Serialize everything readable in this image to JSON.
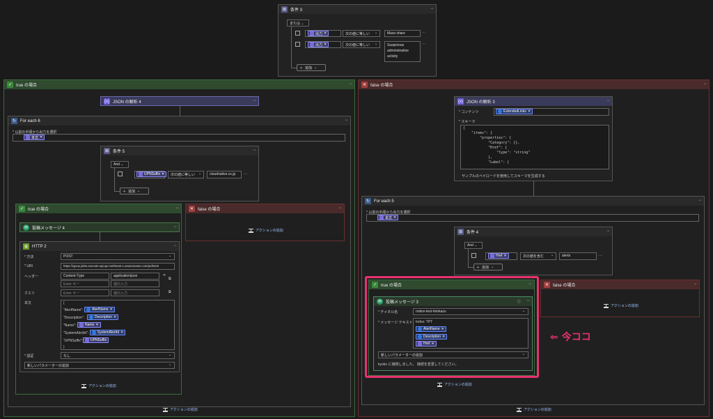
{
  "cond3": {
    "title": "条件 3",
    "logic": "または",
    "row1": {
      "token": "出力",
      "op": "次の値に等しい",
      "value": "Mass share"
    },
    "row2": {
      "token": "出力",
      "op": "次の値に等しい",
      "value": [
        "Suspicious",
        "administrative",
        "activity"
      ]
    },
    "add": "追加"
  },
  "trueBranch": {
    "title": "true の場合",
    "actionAdd": "アクションの追加"
  },
  "falseBranch": {
    "title": "false の場合",
    "actionAdd": "アクションの追加"
  },
  "json4": {
    "title": "JSON の解析 4"
  },
  "foreach6": {
    "title": "For each 6",
    "selectLabel": "* 以前の手順から出力を選択",
    "token": "本文"
  },
  "cond5": {
    "title": "条件 5",
    "logic": "And",
    "token": "UPNSuffix",
    "op": "次の値に等しい",
    "value": "cloudnative.co.jp",
    "add": "追加"
  },
  "true5": {
    "title": "true の場合",
    "actionAdd": "アクションの追加"
  },
  "false5": {
    "title": "false の場合",
    "actionAdd": "アクションの追加"
  },
  "post4": {
    "title": "投稿メッセージ 4"
  },
  "http2": {
    "title": "HTTP 2",
    "methodLabel": "* 方法",
    "method": "POST",
    "uriLabel": "* URI",
    "uri": "https://zgxuu.j5iza.execute-api.ap-northeast-1.amazonaws.com/prd/set2",
    "headerLabel": "ヘッダー",
    "hKey": "Content-Type",
    "hVal": "application/json",
    "hKeyPh": "Enter キー",
    "hValPh": "値の入力",
    "queryLabel": "クエリ",
    "qKeyPh": "Enter キー",
    "qValPh": "値の入力",
    "bodyLabel": "本文",
    "body": {
      "open": "{",
      "l1": "\"AlertName\":",
      "t1": "AlertName",
      "l2": "\"Description\":",
      "t2": "Description",
      "l3": "\"Name\":",
      "t3": "Name",
      "l4": "\"SystemAlertId\":",
      "t4": "SystemAlertId",
      "l5": "\"UPNSuffix\":",
      "t5": "UPNSuffix",
      "close": "}"
    },
    "authLabel": "* 認証",
    "auth": "なし",
    "newParam": "新しいパラメーターの追加"
  },
  "json3": {
    "title": "JSON の解析 3",
    "contentLabel": "* コンテンツ",
    "contentToken": "ExtendedLinks",
    "schemaLabel": "* スキーマ",
    "code": "{\n    \"items\": {\n        \"properties\": {\n            \"Category\": {},\n            \"Href\": {\n                \"type\": \"string\"\n            },\n            \"Label\": {",
    "sample": "サンプルのペイロードを使用してスキーマを生成する"
  },
  "foreach5": {
    "title": "For each 5",
    "selectLabel": "* 以前の手順から出力を選択",
    "token": "本文"
  },
  "cond4": {
    "title": "条件 4",
    "logic": "And",
    "token": "Href",
    "op": "次の値を含む",
    "value": "alerts",
    "add": "追加"
  },
  "true4": {
    "title": "true の場合"
  },
  "false4": {
    "title": "false の場合",
    "actionAdd": "アクションの追加"
  },
  "post3": {
    "title": "投稿メッセージ 3",
    "chanLabel": "* チャネル名",
    "chan": "notice-test-hirokazu",
    "msgLabel": "* メッセージ テキスト",
    "msgPrefix": "Index: TPT",
    "t1": "AlertName",
    "t2": "Description",
    "t3": "Href",
    "newParam": "新しいパラメーターの追加",
    "note": "kyoko に接続しました。 接続を変更してください。",
    "actionAdd": "アクションの追加"
  },
  "annotation": "⇐ 今ココ",
  "colors": {
    "accent": "#e8336e",
    "true": "#3c6b3c",
    "false": "#6b2f2f"
  }
}
